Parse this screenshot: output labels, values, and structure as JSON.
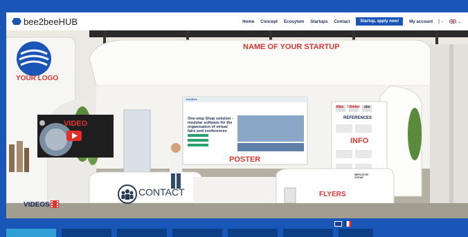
{
  "header": {
    "brand": "bee2beeHUB",
    "nav": [
      "Home",
      "Concept",
      "Ecosytem",
      "Startups",
      "Contact"
    ],
    "cta": "Startup, apply now!",
    "account": "My account"
  },
  "booth": {
    "name_banner": "NAME OF YOUR STARTUP",
    "logo_label": "YOUR LOGO",
    "video_label": "VIDEO",
    "videos_label": "VIDEOS",
    "contact_label": "CONTACT",
    "poster_label": "POSTER",
    "info_label": "INFO",
    "references_label": "REFERENCES",
    "flyers_label": "FLYERS",
    "poster": {
      "brand": "bee2bee",
      "headline": "One-stop Shop solution - modular software for the organisation of virtual fairs and conferences"
    },
    "info_logos": [
      "Afpa",
      "l'Atelier",
      "abe",
      "MERCATOR OCEAN"
    ]
  },
  "colors": {
    "primary": "#1a56b8",
    "banner_text": "#e3352f",
    "dark": "#1a2a55"
  }
}
